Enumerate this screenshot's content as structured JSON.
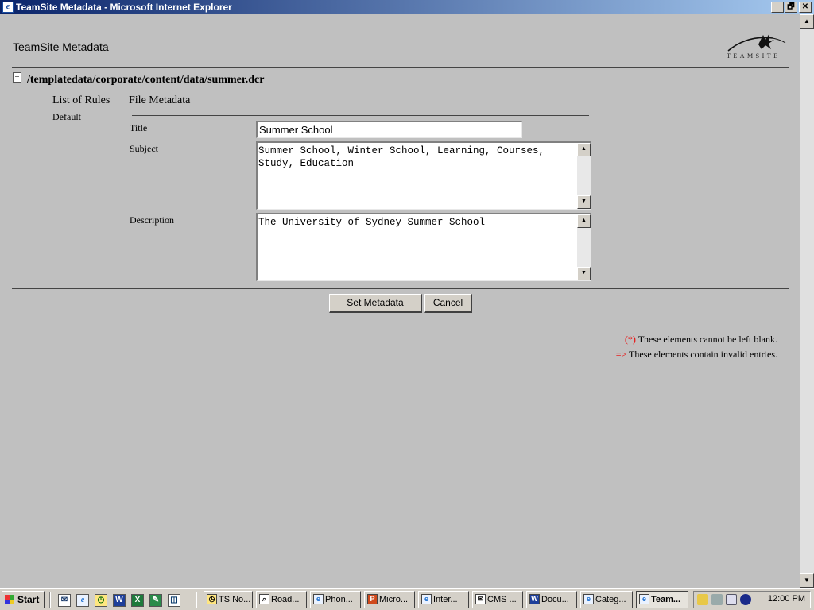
{
  "window": {
    "title": "TeamSite Metadata - Microsoft Internet Explorer",
    "icon": "ie-page-icon",
    "controls": [
      "_",
      "🗗",
      "✕"
    ]
  },
  "header": {
    "title": "TeamSite Metadata",
    "logo_text": "TEAMSITE"
  },
  "file": {
    "icon": "document-icon",
    "path": "/templatedata/corporate/content/data/summer.dcr"
  },
  "nav": {
    "list_of_rules": "List of Rules",
    "file_metadata": "File Metadata",
    "default": "Default"
  },
  "form": {
    "title_label": "Title",
    "title_value": "Summer School",
    "subject_label": "Subject",
    "subject_value": "Summer School, Winter School, Learning, Courses, Study, Education",
    "description_label": "Description",
    "description_value": "The University of Sydney Summer School",
    "set_metadata_button": "Set Metadata",
    "cancel_button": "Cancel"
  },
  "legend": {
    "required_marker": "(*)",
    "required_text": " These elements cannot be left blank.",
    "invalid_marker": "=>",
    "invalid_text": " These elements contain invalid entries."
  },
  "taskbar": {
    "start_label": "Start",
    "quick_launch": [
      "outlook-icon",
      "ie-icon",
      "clock-icon",
      "word-icon",
      "excel-icon",
      "image-editor-icon",
      "messenger-icon"
    ],
    "tasks": [
      {
        "label": "TS No...",
        "icon": "clock-icon"
      },
      {
        "label": "Road...",
        "icon": "search-icon"
      },
      {
        "label": "Phon...",
        "icon": "ie-icon"
      },
      {
        "label": "Micro...",
        "icon": "powerpoint-icon"
      },
      {
        "label": "Inter...",
        "icon": "ie-icon"
      },
      {
        "label": "CMS ...",
        "icon": "mail-icon"
      },
      {
        "label": "Docu...",
        "icon": "word-icon"
      },
      {
        "label": "Categ...",
        "icon": "ie-icon"
      },
      {
        "label": "Team...",
        "icon": "ie-icon",
        "active": true
      }
    ],
    "clock": "12:00 PM"
  },
  "colors": {
    "page_bg": "#c0c0c0",
    "titlebar_start": "#0a246a",
    "titlebar_end": "#a6caf0",
    "required_red": "#e00000"
  }
}
